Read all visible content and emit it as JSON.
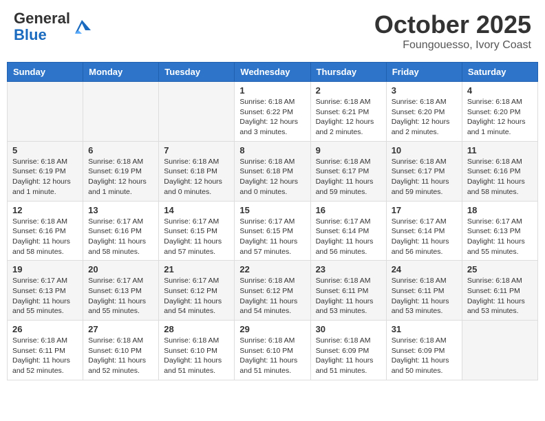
{
  "header": {
    "logo_line1": "General",
    "logo_line2": "Blue",
    "month": "October 2025",
    "location": "Foungouesso, Ivory Coast"
  },
  "weekdays": [
    "Sunday",
    "Monday",
    "Tuesday",
    "Wednesday",
    "Thursday",
    "Friday",
    "Saturday"
  ],
  "weeks": [
    [
      {
        "day": "",
        "text": ""
      },
      {
        "day": "",
        "text": ""
      },
      {
        "day": "",
        "text": ""
      },
      {
        "day": "1",
        "text": "Sunrise: 6:18 AM\nSunset: 6:22 PM\nDaylight: 12 hours and 3 minutes."
      },
      {
        "day": "2",
        "text": "Sunrise: 6:18 AM\nSunset: 6:21 PM\nDaylight: 12 hours and 2 minutes."
      },
      {
        "day": "3",
        "text": "Sunrise: 6:18 AM\nSunset: 6:20 PM\nDaylight: 12 hours and 2 minutes."
      },
      {
        "day": "4",
        "text": "Sunrise: 6:18 AM\nSunset: 6:20 PM\nDaylight: 12 hours and 1 minute."
      }
    ],
    [
      {
        "day": "5",
        "text": "Sunrise: 6:18 AM\nSunset: 6:19 PM\nDaylight: 12 hours and 1 minute."
      },
      {
        "day": "6",
        "text": "Sunrise: 6:18 AM\nSunset: 6:19 PM\nDaylight: 12 hours and 1 minute."
      },
      {
        "day": "7",
        "text": "Sunrise: 6:18 AM\nSunset: 6:18 PM\nDaylight: 12 hours and 0 minutes."
      },
      {
        "day": "8",
        "text": "Sunrise: 6:18 AM\nSunset: 6:18 PM\nDaylight: 12 hours and 0 minutes."
      },
      {
        "day": "9",
        "text": "Sunrise: 6:18 AM\nSunset: 6:17 PM\nDaylight: 11 hours and 59 minutes."
      },
      {
        "day": "10",
        "text": "Sunrise: 6:18 AM\nSunset: 6:17 PM\nDaylight: 11 hours and 59 minutes."
      },
      {
        "day": "11",
        "text": "Sunrise: 6:18 AM\nSunset: 6:16 PM\nDaylight: 11 hours and 58 minutes."
      }
    ],
    [
      {
        "day": "12",
        "text": "Sunrise: 6:18 AM\nSunset: 6:16 PM\nDaylight: 11 hours and 58 minutes."
      },
      {
        "day": "13",
        "text": "Sunrise: 6:17 AM\nSunset: 6:16 PM\nDaylight: 11 hours and 58 minutes."
      },
      {
        "day": "14",
        "text": "Sunrise: 6:17 AM\nSunset: 6:15 PM\nDaylight: 11 hours and 57 minutes."
      },
      {
        "day": "15",
        "text": "Sunrise: 6:17 AM\nSunset: 6:15 PM\nDaylight: 11 hours and 57 minutes."
      },
      {
        "day": "16",
        "text": "Sunrise: 6:17 AM\nSunset: 6:14 PM\nDaylight: 11 hours and 56 minutes."
      },
      {
        "day": "17",
        "text": "Sunrise: 6:17 AM\nSunset: 6:14 PM\nDaylight: 11 hours and 56 minutes."
      },
      {
        "day": "18",
        "text": "Sunrise: 6:17 AM\nSunset: 6:13 PM\nDaylight: 11 hours and 55 minutes."
      }
    ],
    [
      {
        "day": "19",
        "text": "Sunrise: 6:17 AM\nSunset: 6:13 PM\nDaylight: 11 hours and 55 minutes."
      },
      {
        "day": "20",
        "text": "Sunrise: 6:17 AM\nSunset: 6:13 PM\nDaylight: 11 hours and 55 minutes."
      },
      {
        "day": "21",
        "text": "Sunrise: 6:17 AM\nSunset: 6:12 PM\nDaylight: 11 hours and 54 minutes."
      },
      {
        "day": "22",
        "text": "Sunrise: 6:18 AM\nSunset: 6:12 PM\nDaylight: 11 hours and 54 minutes."
      },
      {
        "day": "23",
        "text": "Sunrise: 6:18 AM\nSunset: 6:11 PM\nDaylight: 11 hours and 53 minutes."
      },
      {
        "day": "24",
        "text": "Sunrise: 6:18 AM\nSunset: 6:11 PM\nDaylight: 11 hours and 53 minutes."
      },
      {
        "day": "25",
        "text": "Sunrise: 6:18 AM\nSunset: 6:11 PM\nDaylight: 11 hours and 53 minutes."
      }
    ],
    [
      {
        "day": "26",
        "text": "Sunrise: 6:18 AM\nSunset: 6:11 PM\nDaylight: 11 hours and 52 minutes."
      },
      {
        "day": "27",
        "text": "Sunrise: 6:18 AM\nSunset: 6:10 PM\nDaylight: 11 hours and 52 minutes."
      },
      {
        "day": "28",
        "text": "Sunrise: 6:18 AM\nSunset: 6:10 PM\nDaylight: 11 hours and 51 minutes."
      },
      {
        "day": "29",
        "text": "Sunrise: 6:18 AM\nSunset: 6:10 PM\nDaylight: 11 hours and 51 minutes."
      },
      {
        "day": "30",
        "text": "Sunrise: 6:18 AM\nSunset: 6:09 PM\nDaylight: 11 hours and 51 minutes."
      },
      {
        "day": "31",
        "text": "Sunrise: 6:18 AM\nSunset: 6:09 PM\nDaylight: 11 hours and 50 minutes."
      },
      {
        "day": "",
        "text": ""
      }
    ]
  ]
}
